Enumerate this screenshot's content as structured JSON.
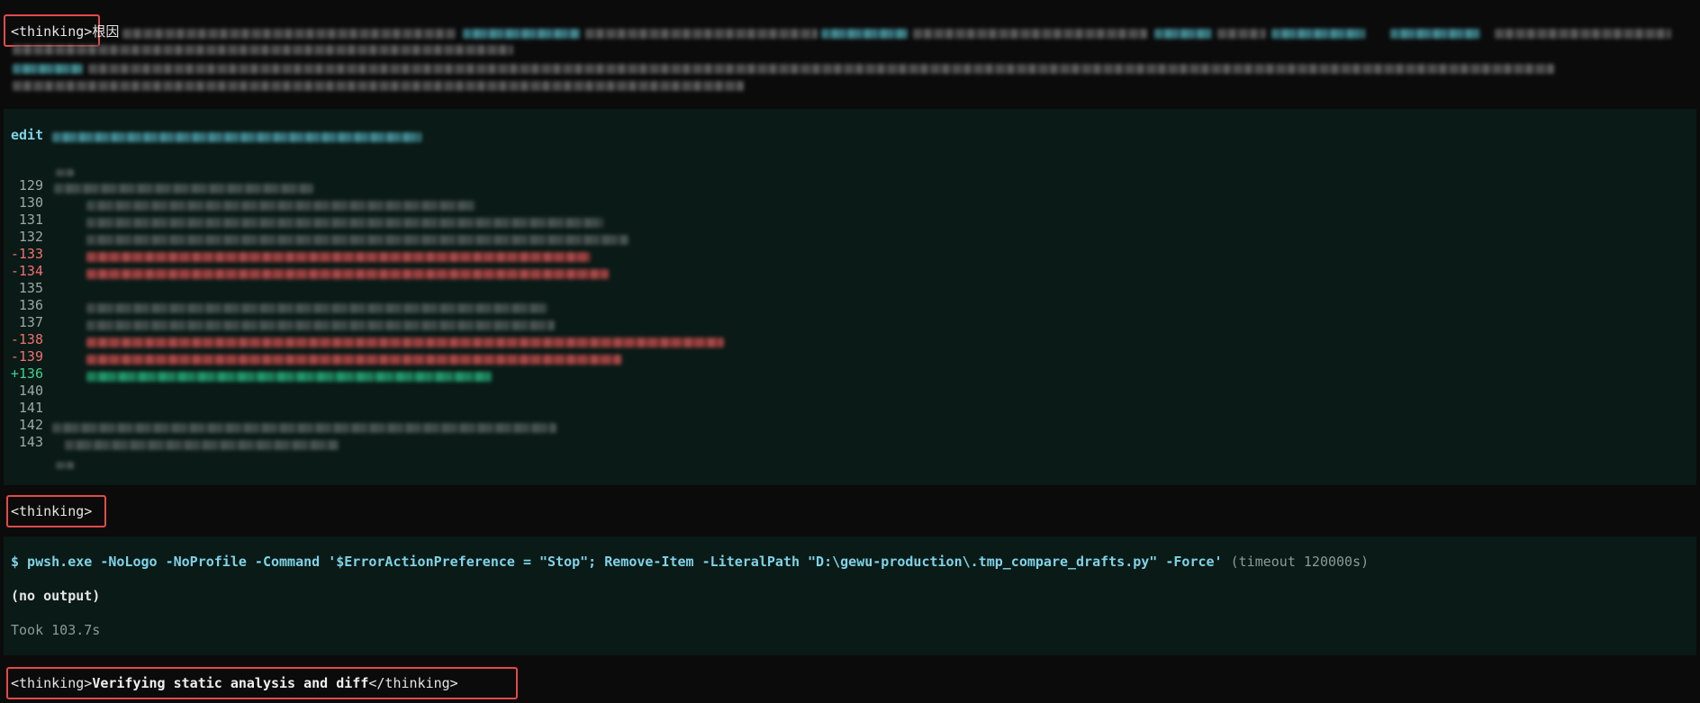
{
  "thinking_blocks": [
    {
      "open_tag": "<thinking>",
      "text": "根因"
    },
    {
      "open_tag": "<thinking>"
    },
    {
      "open_tag": "<thinking>",
      "text": "Verifying static analysis and diff",
      "close_tag": "</thinking>"
    }
  ],
  "edit": {
    "label": "edit",
    "lines": [
      {
        "num": "129",
        "kind": "ctx"
      },
      {
        "num": "130",
        "kind": "ctx"
      },
      {
        "num": "131",
        "kind": "ctx"
      },
      {
        "num": "132",
        "kind": "ctx"
      },
      {
        "num": "-133",
        "kind": "del"
      },
      {
        "num": "-134",
        "kind": "del"
      },
      {
        "num": "135",
        "kind": "ctx"
      },
      {
        "num": "136",
        "kind": "ctx"
      },
      {
        "num": "137",
        "kind": "ctx"
      },
      {
        "num": "-138",
        "kind": "del"
      },
      {
        "num": "-139",
        "kind": "del"
      },
      {
        "num": "+136",
        "kind": "add"
      },
      {
        "num": "140",
        "kind": "ctx"
      },
      {
        "num": "141",
        "kind": "ctx"
      },
      {
        "num": "142",
        "kind": "ctx"
      },
      {
        "num": "143",
        "kind": "ctx"
      }
    ]
  },
  "command": {
    "text": "$ pwsh.exe -NoLogo -NoProfile -Command '$ErrorActionPreference = \"Stop\"; Remove-Item -LiteralPath \"D:\\gewu-production\\.tmp_compare_drafts.py\" -Force'",
    "timeout": "(timeout 120000s)",
    "output": "(no output)",
    "took": "Took 103.7s"
  },
  "colors": {
    "background": "#0b0b0b",
    "panel": "#0a1a16",
    "highlight_border": "#e34a4a",
    "command_text": "#7fd3e8",
    "deleted": "#f07070",
    "added": "#3fd18f"
  }
}
